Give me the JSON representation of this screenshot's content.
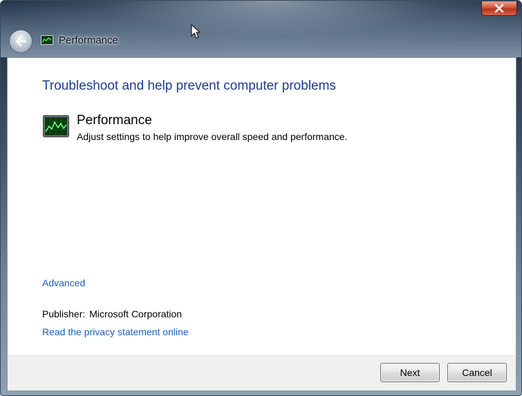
{
  "window": {
    "title": "Performance",
    "icons": {
      "back": "back-arrow-icon",
      "close": "close-icon",
      "app": "performance-app-icon"
    }
  },
  "main": {
    "heading": "Troubleshoot and help prevent computer problems",
    "item": {
      "title": "Performance",
      "description": "Adjust settings to help improve overall speed and performance.",
      "icon": "performance-monitor-icon"
    },
    "advanced_link": "Advanced",
    "publisher_label": "Publisher:",
    "publisher_value": "Microsoft Corporation",
    "privacy_link": "Read the privacy statement online"
  },
  "footer": {
    "next_label": "Next",
    "cancel_label": "Cancel"
  },
  "colors": {
    "heading": "#1e3a8a",
    "link": "#1a5fb4",
    "close_button": "#c8452c"
  }
}
